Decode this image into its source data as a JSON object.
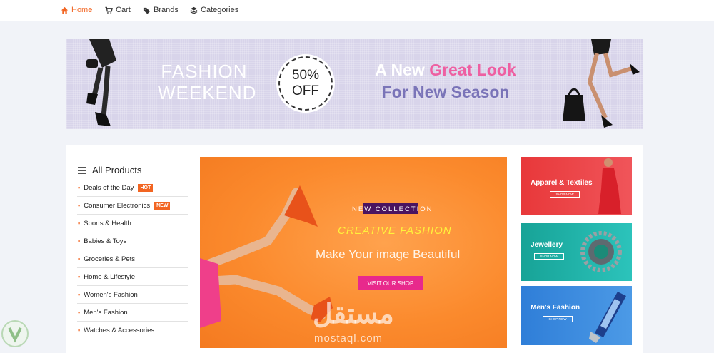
{
  "nav": {
    "items": [
      {
        "label": "Home",
        "icon": "home-icon",
        "active": true
      },
      {
        "label": "Cart",
        "icon": "cart-icon",
        "active": false
      },
      {
        "label": "Brands",
        "icon": "tags-icon",
        "active": false
      },
      {
        "label": "Categories",
        "icon": "layers-icon",
        "active": false
      }
    ]
  },
  "banner": {
    "line1": "FASHION",
    "line2": "WEEKEND",
    "discount_pct": "50%",
    "discount_off": "OFF",
    "tagline_a": "A New",
    "tagline_b": "Great Look",
    "tagline_c": "For New Season"
  },
  "sidebar": {
    "title": "All Products",
    "items": [
      {
        "label": "Deals of the Day",
        "tag": "HOT"
      },
      {
        "label": "Consumer Electronics",
        "tag": "NEW"
      },
      {
        "label": "Sports & Health",
        "tag": ""
      },
      {
        "label": "Babies & Toys",
        "tag": ""
      },
      {
        "label": "Groceries & Pets",
        "tag": ""
      },
      {
        "label": "Home & Lifestyle",
        "tag": ""
      },
      {
        "label": "Women's Fashion",
        "tag": ""
      },
      {
        "label": "Men's Fashion",
        "tag": ""
      },
      {
        "label": "Watches & Accessories",
        "tag": ""
      }
    ]
  },
  "hero": {
    "eyebrow": "NEW COLLECTION",
    "headline": "CREATIVE FASHION",
    "subhead": "Make Your image Beautiful",
    "cta": "VISIT OUR SHOP"
  },
  "promos": [
    {
      "title": "Apparel & Textiles",
      "cta": "SHOP NOW"
    },
    {
      "title": "Jewellery",
      "cta": "SHOP NOW"
    },
    {
      "title": "Men's Fashion",
      "cta": "SHOP NOW"
    }
  ],
  "watermark": {
    "arabic": "مستقل",
    "latin": "mostaql.com"
  },
  "colors": {
    "accent": "#f26522",
    "hero_bg": "#fb8a2d",
    "cta_pink": "#e8298c",
    "banner_bg": "#d8d4ea"
  }
}
